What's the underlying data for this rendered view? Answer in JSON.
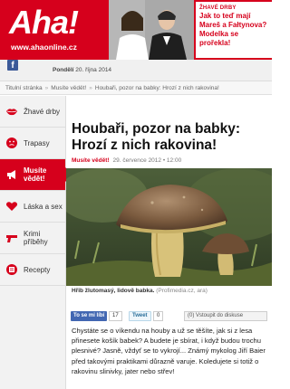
{
  "header": {
    "logo": "Aha!",
    "logo_url": "www.ahaonline.cz",
    "promo_tag": "ŽHAVÉ DRBY",
    "promo_title": "Jak to teď mají Mareš a Fałtynova? Modelka se prořekla!"
  },
  "social": {
    "date_day": "Pondělí",
    "date_rest": "20. října 2014"
  },
  "breadcrumb": {
    "items": [
      "Titulní stránka",
      "Musíte vědět!",
      "Houbaři, pozor na babky: Hrozí z nich rakovina!"
    ]
  },
  "sidebar": {
    "items": [
      {
        "label": "Žhavé drby",
        "icon": "lips-icon"
      },
      {
        "label": "Trapasy",
        "icon": "face-icon"
      },
      {
        "label": "Musíte vědět!",
        "icon": "megaphone-icon",
        "active": true
      },
      {
        "label": "Láska a sex",
        "icon": "heart-icon"
      },
      {
        "label": "Krimi příběhy",
        "icon": "gun-icon"
      },
      {
        "label": "Recepty",
        "icon": "recipe-icon"
      }
    ]
  },
  "article": {
    "title": "Houbaři, pozor na babky: Hrozí z nich rakovina!",
    "section": "Musíte vědět!",
    "date": "29. července 2012 • 12:00",
    "caption_bold": "Hřib žlutomasý, lidově babka.",
    "caption_source": "(Profimedia.cz, ara)",
    "share_fb": "To se mi líbí",
    "share_fb_count": "17",
    "share_tw": "Tweet",
    "share_tw_count": "0",
    "discussion": "(0) Vstoupit do diskuse",
    "lead": "Chystáte se o víkendu na houby a už se těšíte, jak si z lesa přinesete košík babek? A budete je sbírat, i když budou trochu plesnivé? Jasně, vždyť se to vykrojí... Známý mykolog Jiří Baier před takovými praktikami důrazně varuje. Koledujete si totiž o rakovinu slinivky, jater nebo střev!"
  },
  "colors": {
    "brand_red": "#d6001c",
    "facebook": "#3b5998"
  }
}
